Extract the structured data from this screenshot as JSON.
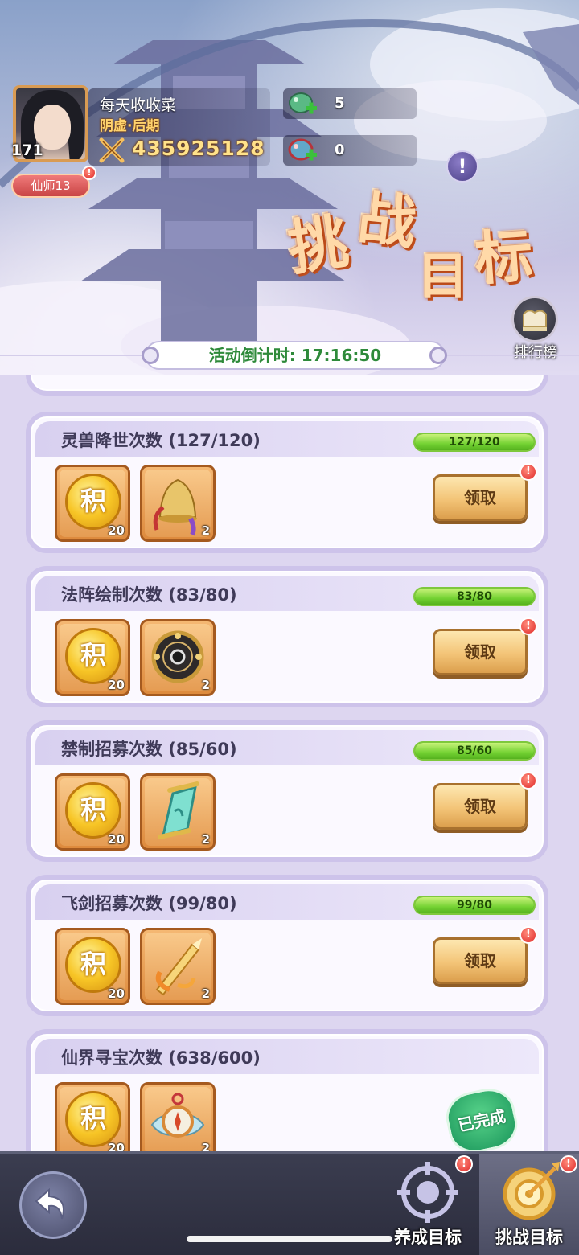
{
  "player": {
    "name": "每天收收菜",
    "rank": "阴虚·后期",
    "level": "171",
    "power": "435925128",
    "title_badge": "仙师13"
  },
  "currencies": [
    {
      "icon": "jade-dragon-icon",
      "value": "5"
    },
    {
      "icon": "red-dragon-icon",
      "value": "0"
    }
  ],
  "event": {
    "title_chars": [
      "挑",
      "战",
      "目",
      "标"
    ],
    "countdown": "活动倒计时: 17:16:50",
    "ranking_label": "排行榜"
  },
  "tasks": [
    {
      "title": "灵兽降世次数 (127/120)",
      "progress_text": "127/120",
      "progress": 1.0,
      "rewards": [
        {
          "icon": "points-coin-icon",
          "glyph": "积",
          "count": "20"
        },
        {
          "icon": "golden-bell-icon",
          "count": "2"
        }
      ],
      "action": "领取",
      "claimable": true
    },
    {
      "title": "法阵绘制次数 (83/80)",
      "progress_text": "83/80",
      "progress": 1.0,
      "rewards": [
        {
          "icon": "points-coin-icon",
          "glyph": "积",
          "count": "20"
        },
        {
          "icon": "array-disc-icon",
          "count": "2"
        }
      ],
      "action": "领取",
      "claimable": true
    },
    {
      "title": "禁制招募次数 (85/60)",
      "progress_text": "85/60",
      "progress": 1.0,
      "rewards": [
        {
          "icon": "points-coin-icon",
          "glyph": "积",
          "count": "20"
        },
        {
          "icon": "jade-scroll-icon",
          "count": "2"
        }
      ],
      "action": "领取",
      "claimable": true
    },
    {
      "title": "飞剑招募次数 (99/80)",
      "progress_text": "99/80",
      "progress": 1.0,
      "rewards": [
        {
          "icon": "points-coin-icon",
          "glyph": "积",
          "count": "20"
        },
        {
          "icon": "flying-sword-icon",
          "count": "2"
        }
      ],
      "action": "领取",
      "claimable": true
    },
    {
      "title": "仙界寻宝次数 (638/600)",
      "rewards": [
        {
          "icon": "points-coin-icon",
          "glyph": "积",
          "count": "20"
        },
        {
          "icon": "treasure-compass-icon",
          "count": "2"
        }
      ],
      "status": "已完成",
      "claimable": false
    }
  ],
  "alert_mark": "!",
  "nav": {
    "tabs": [
      {
        "label": "养成目标",
        "icon": "crosshair-target-icon",
        "active": false
      },
      {
        "label": "挑战目标",
        "icon": "dart-target-icon",
        "active": true
      }
    ]
  },
  "colors": {
    "progress_green": "#74d233",
    "claim_gold": "#f3c477",
    "done_green": "#19955a",
    "card_border": "#cdc3ea"
  }
}
